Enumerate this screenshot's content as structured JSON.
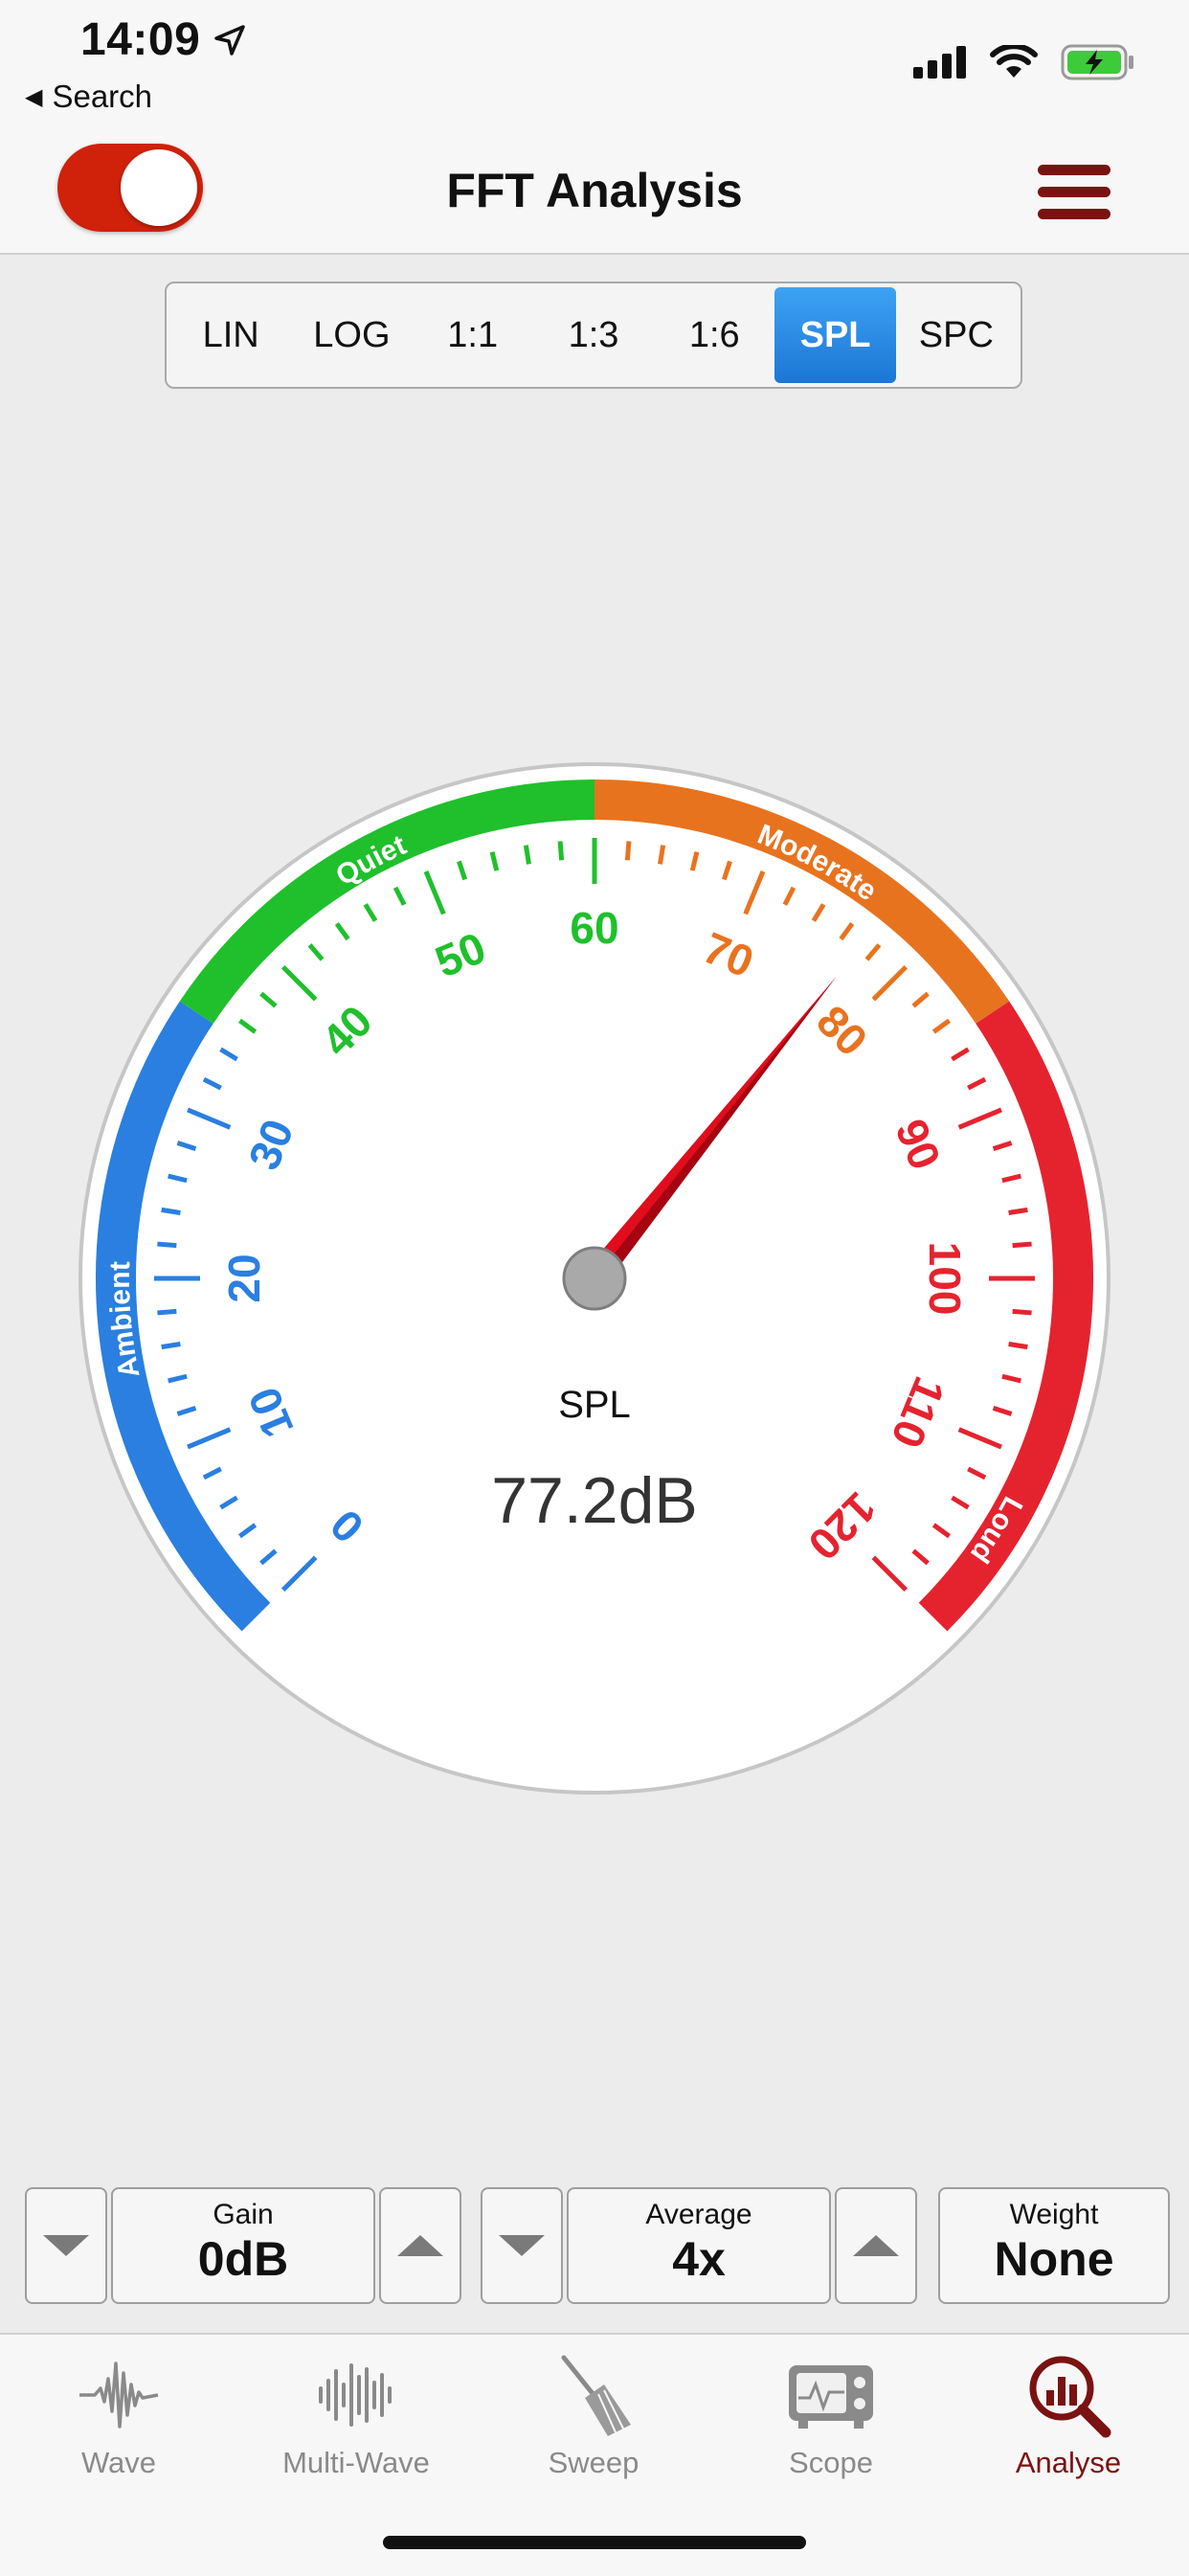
{
  "status_bar": {
    "time": "14:09",
    "back_label": "Search"
  },
  "navbar": {
    "title": "FFT Analysis",
    "toggle_on": true
  },
  "modes": [
    {
      "label": "LIN",
      "active": false
    },
    {
      "label": "LOG",
      "active": false
    },
    {
      "label": "1:1",
      "active": false
    },
    {
      "label": "1:3",
      "active": false
    },
    {
      "label": "1:6",
      "active": false
    },
    {
      "label": "SPL",
      "active": true
    },
    {
      "label": "SPC",
      "active": false
    }
  ],
  "gauge": {
    "label": "SPL",
    "value_text": "77.2dB",
    "value": 77.2,
    "min": 0,
    "max": 120,
    "major_ticks": [
      0,
      10,
      20,
      30,
      40,
      50,
      60,
      70,
      80,
      90,
      100,
      110,
      120
    ],
    "zones": [
      {
        "name": "Ambient",
        "from": 0,
        "to": 35,
        "color": "#2a7fe0"
      },
      {
        "name": "Quiet",
        "from": 35,
        "to": 60,
        "color": "#1fc02c"
      },
      {
        "name": "Moderate",
        "from": 60,
        "to": 85,
        "color": "#e8731f"
      },
      {
        "name": "Loud",
        "from": 85,
        "to": 120,
        "color": "#e5232f"
      }
    ],
    "needle_color": "#e00d1c"
  },
  "controls": {
    "gain": {
      "label": "Gain",
      "value": "0dB"
    },
    "average": {
      "label": "Average",
      "value": "4x"
    },
    "weight": {
      "label": "Weight",
      "value": "None"
    }
  },
  "tabs": [
    {
      "label": "Wave",
      "icon": "wave-icon",
      "active": false
    },
    {
      "label": "Multi-Wave",
      "icon": "multi-wave-icon",
      "active": false
    },
    {
      "label": "Sweep",
      "icon": "broom-icon",
      "active": false
    },
    {
      "label": "Scope",
      "icon": "oscilloscope-icon",
      "active": false
    },
    {
      "label": "Analyse",
      "icon": "magnifier-chart-icon",
      "active": true
    }
  ],
  "colors": {
    "accent": "#7b1212",
    "toggle": "#d0210b",
    "segment_active": "#1f7ee0"
  }
}
